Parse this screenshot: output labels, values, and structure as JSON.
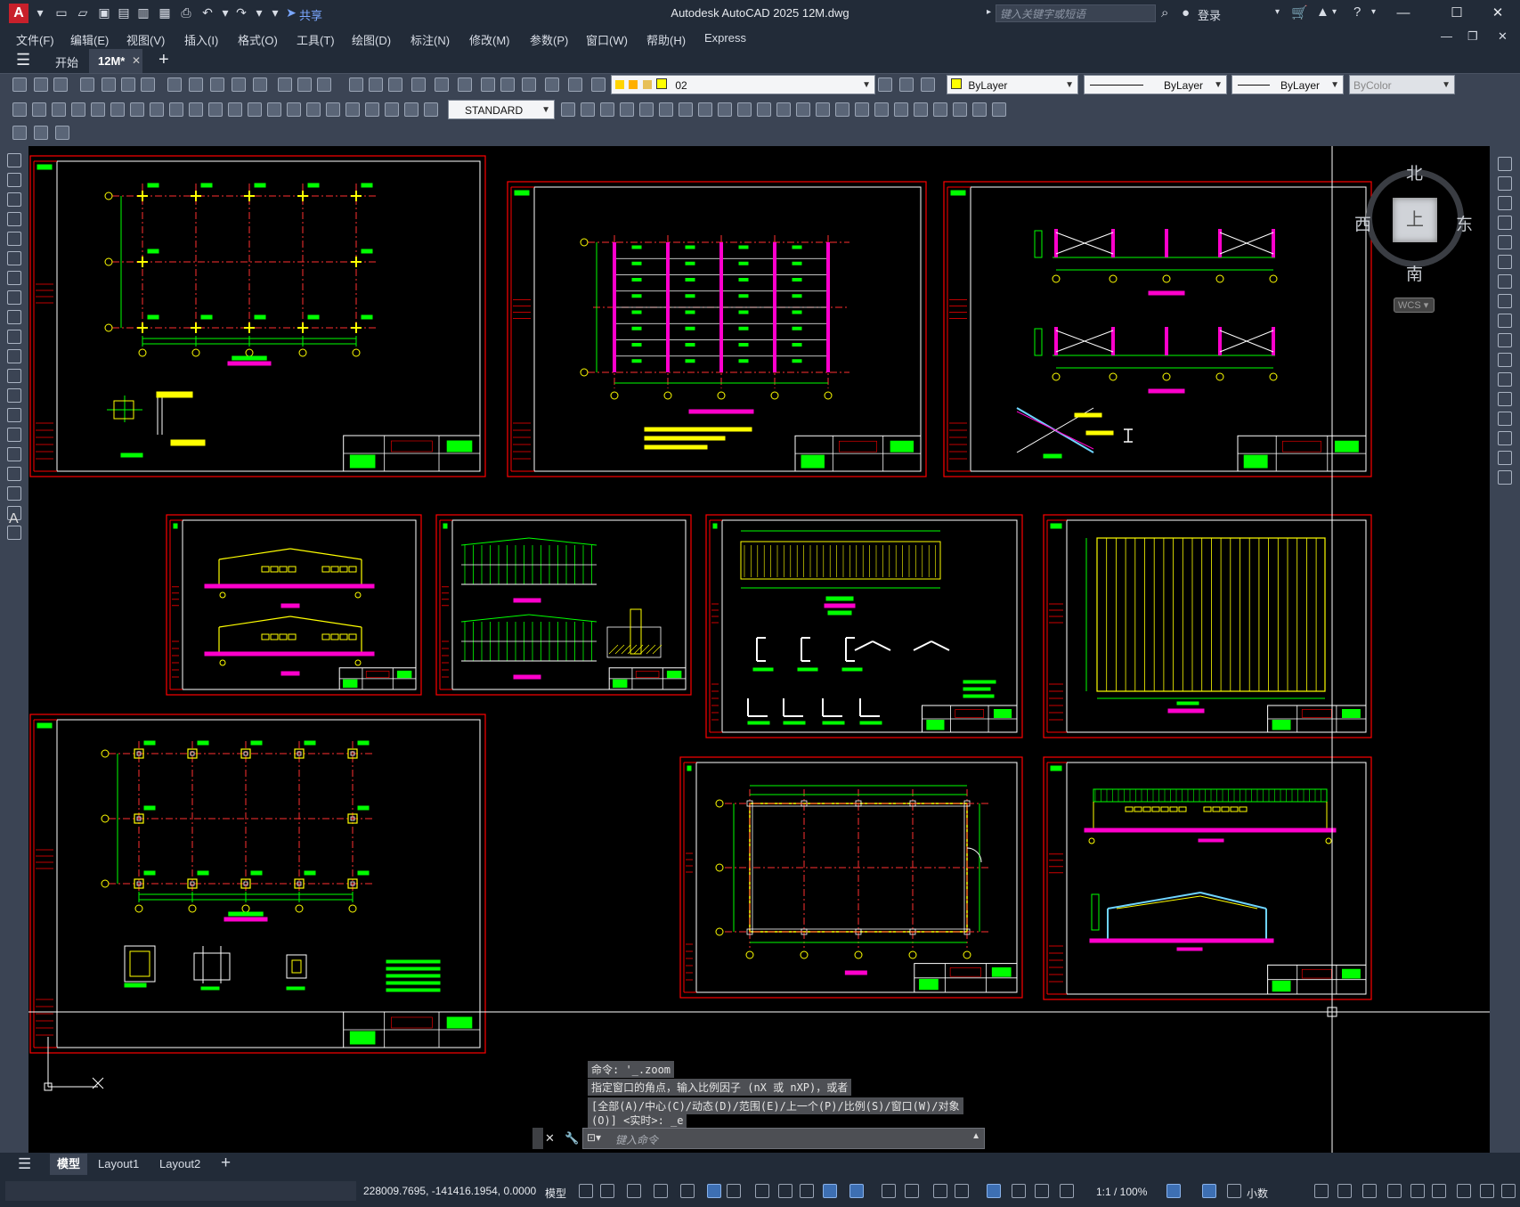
{
  "app": {
    "title": "Autodesk AutoCAD 2025    12M.dwg",
    "logo": "A",
    "share": "共享",
    "search_placeholder": "键入关键字或短语",
    "login": "登录"
  },
  "menu": [
    "文件(F)",
    "编辑(E)",
    "视图(V)",
    "插入(I)",
    "格式(O)",
    "工具(T)",
    "绘图(D)",
    "标注(N)",
    "修改(M)",
    "参数(P)",
    "窗口(W)",
    "帮助(H)",
    "Express"
  ],
  "tabs": {
    "start": "开始",
    "file": "12M*",
    "add": "+"
  },
  "toolbar": {
    "layer_name": "02",
    "color": "ByLayer",
    "linetype": "ByLayer",
    "lineweight": "ByLayer",
    "plotstyle": "ByColor",
    "textstyle": "STANDARD"
  },
  "viewcube": {
    "north": "北",
    "south": "南",
    "east": "东",
    "west": "西",
    "face": "上",
    "wcs": "WCS"
  },
  "command": {
    "history": [
      "命令: '_.zoom",
      "指定窗口的角点，输入比例因子 (nX 或 nXP)，或者",
      "[全部(A)/中心(C)/动态(D)/范围(E)/上一个(P)/比例(S)/窗口(W)/对象",
      "(O)] <实时>: _e"
    ],
    "placeholder": "键入命令"
  },
  "layouts": [
    "模型",
    "Layout1",
    "Layout2"
  ],
  "status": {
    "coordinates": "228009.7695, -141416.1954, 0.0000",
    "space": "模型",
    "scale": "1:1 / 100%",
    "units": "小数"
  },
  "drawings": {
    "labels": [
      "DJ-1",
      "地脚螺栓M24",
      "ZC-1",
      "1-1",
      "2-2",
      "3-3"
    ]
  },
  "colors": {
    "frame": "#ff0000",
    "grid": "#ff3030",
    "pink": "#ff00cc",
    "green": "#00ff00",
    "yellow": "#ffff00"
  }
}
